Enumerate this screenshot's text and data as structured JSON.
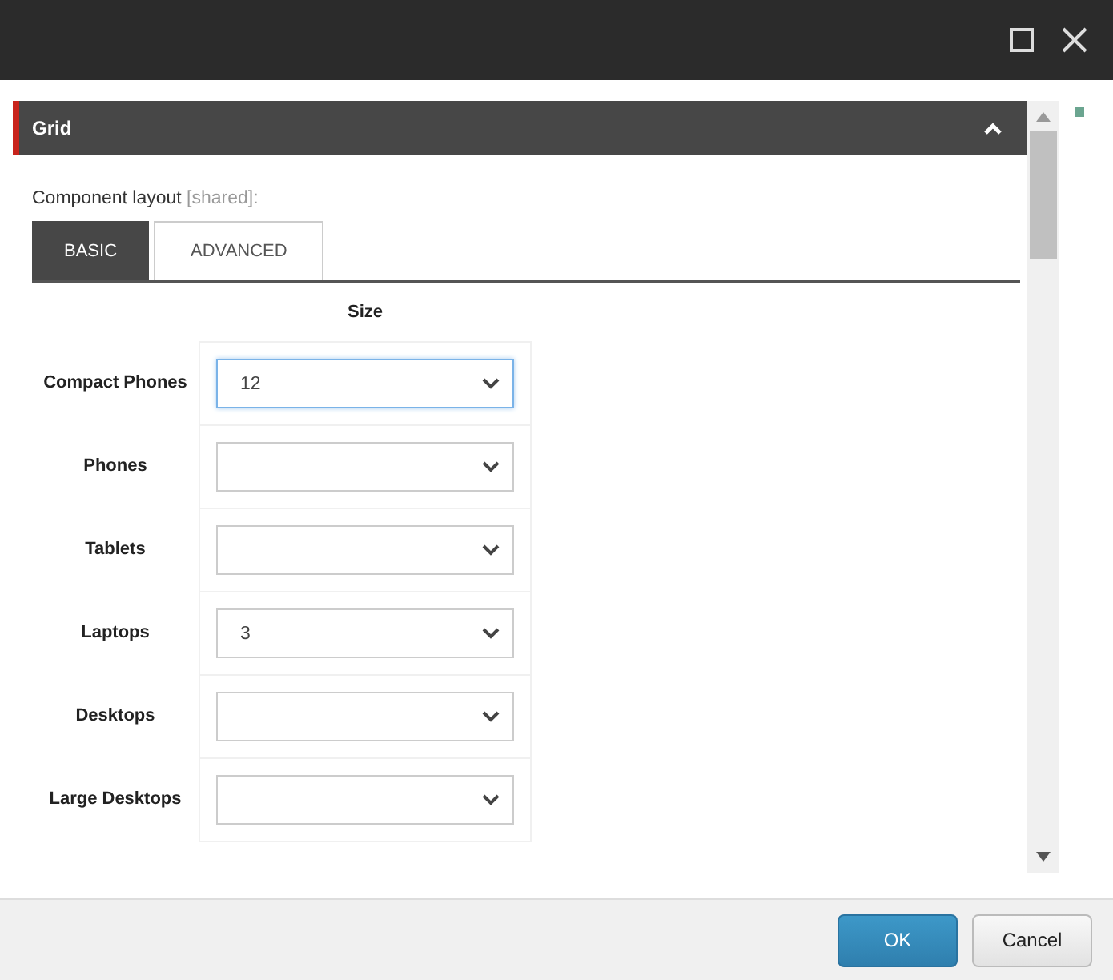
{
  "section": {
    "title": "Grid",
    "expanded": true
  },
  "field_label": {
    "text": "Component layout",
    "note": "[shared]:"
  },
  "tabs": [
    {
      "label": "BASIC",
      "selected": true
    },
    {
      "label": "ADVANCED",
      "selected": false
    }
  ],
  "column_header": "Size",
  "rows": [
    {
      "label": "Compact Phones",
      "value": "12",
      "focused": true
    },
    {
      "label": "Phones",
      "value": "",
      "focused": false
    },
    {
      "label": "Tablets",
      "value": "",
      "focused": false
    },
    {
      "label": "Laptops",
      "value": "3",
      "focused": false
    },
    {
      "label": "Desktops",
      "value": "",
      "focused": false
    },
    {
      "label": "Large Desktops",
      "value": "",
      "focused": false
    }
  ],
  "buttons": [
    {
      "label": "OK",
      "kind": "primary"
    },
    {
      "label": "Cancel",
      "kind": "secondary"
    }
  ]
}
